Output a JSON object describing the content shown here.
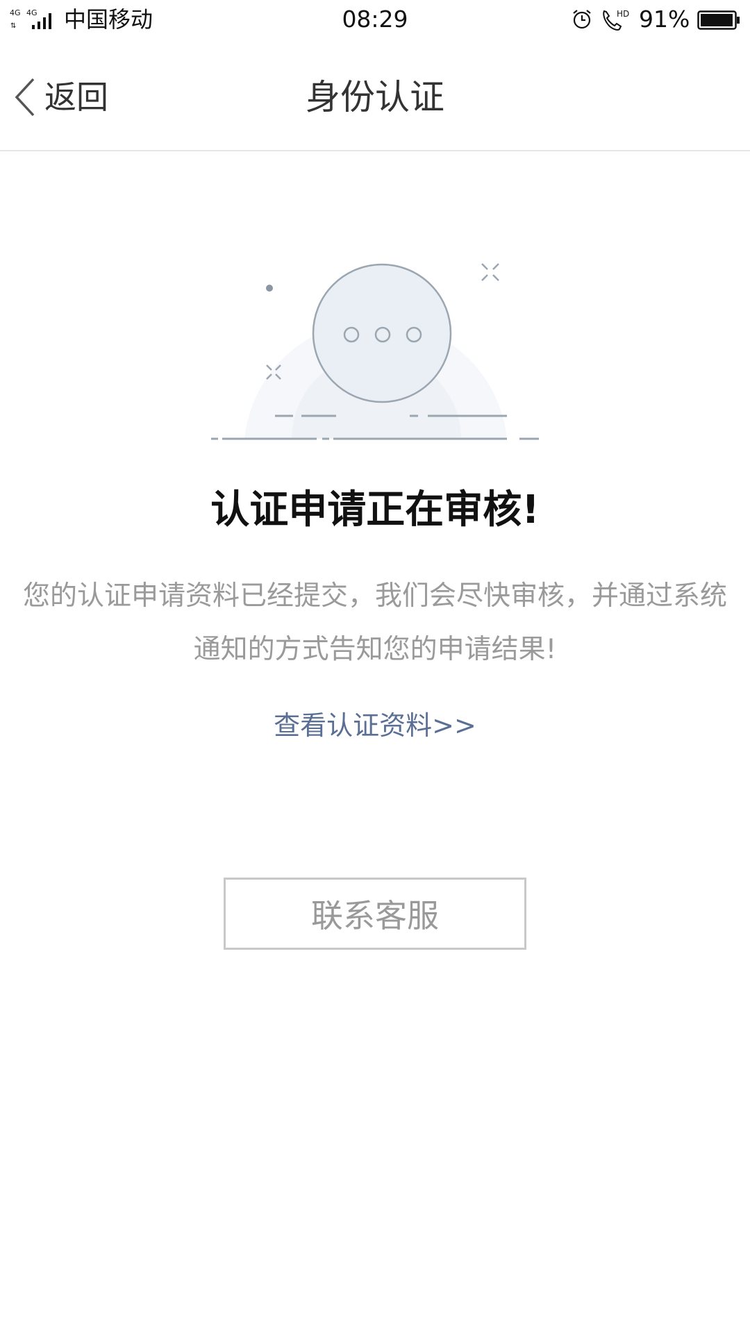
{
  "status_bar": {
    "network": "4G 4G",
    "carrier": "中国移动",
    "time": "08:29",
    "battery_percent": "91%",
    "icons": [
      "signal-icon",
      "alarm-icon",
      "hd-call-icon",
      "battery-icon"
    ]
  },
  "nav": {
    "back_label": "返回",
    "title": "身份认证"
  },
  "main": {
    "heading": "认证申请正在审核!",
    "description": "您的认证申请资料已经提交，我们会尽快审核，并通过系统通知的方式告知您的申请结果!",
    "view_link": "查看认证资料>>",
    "contact_button": "联系客服"
  },
  "colors": {
    "link": "#5b6f95",
    "muted_text": "#9a9a9a",
    "heading": "#111111",
    "button_border": "#c8c8c8"
  }
}
